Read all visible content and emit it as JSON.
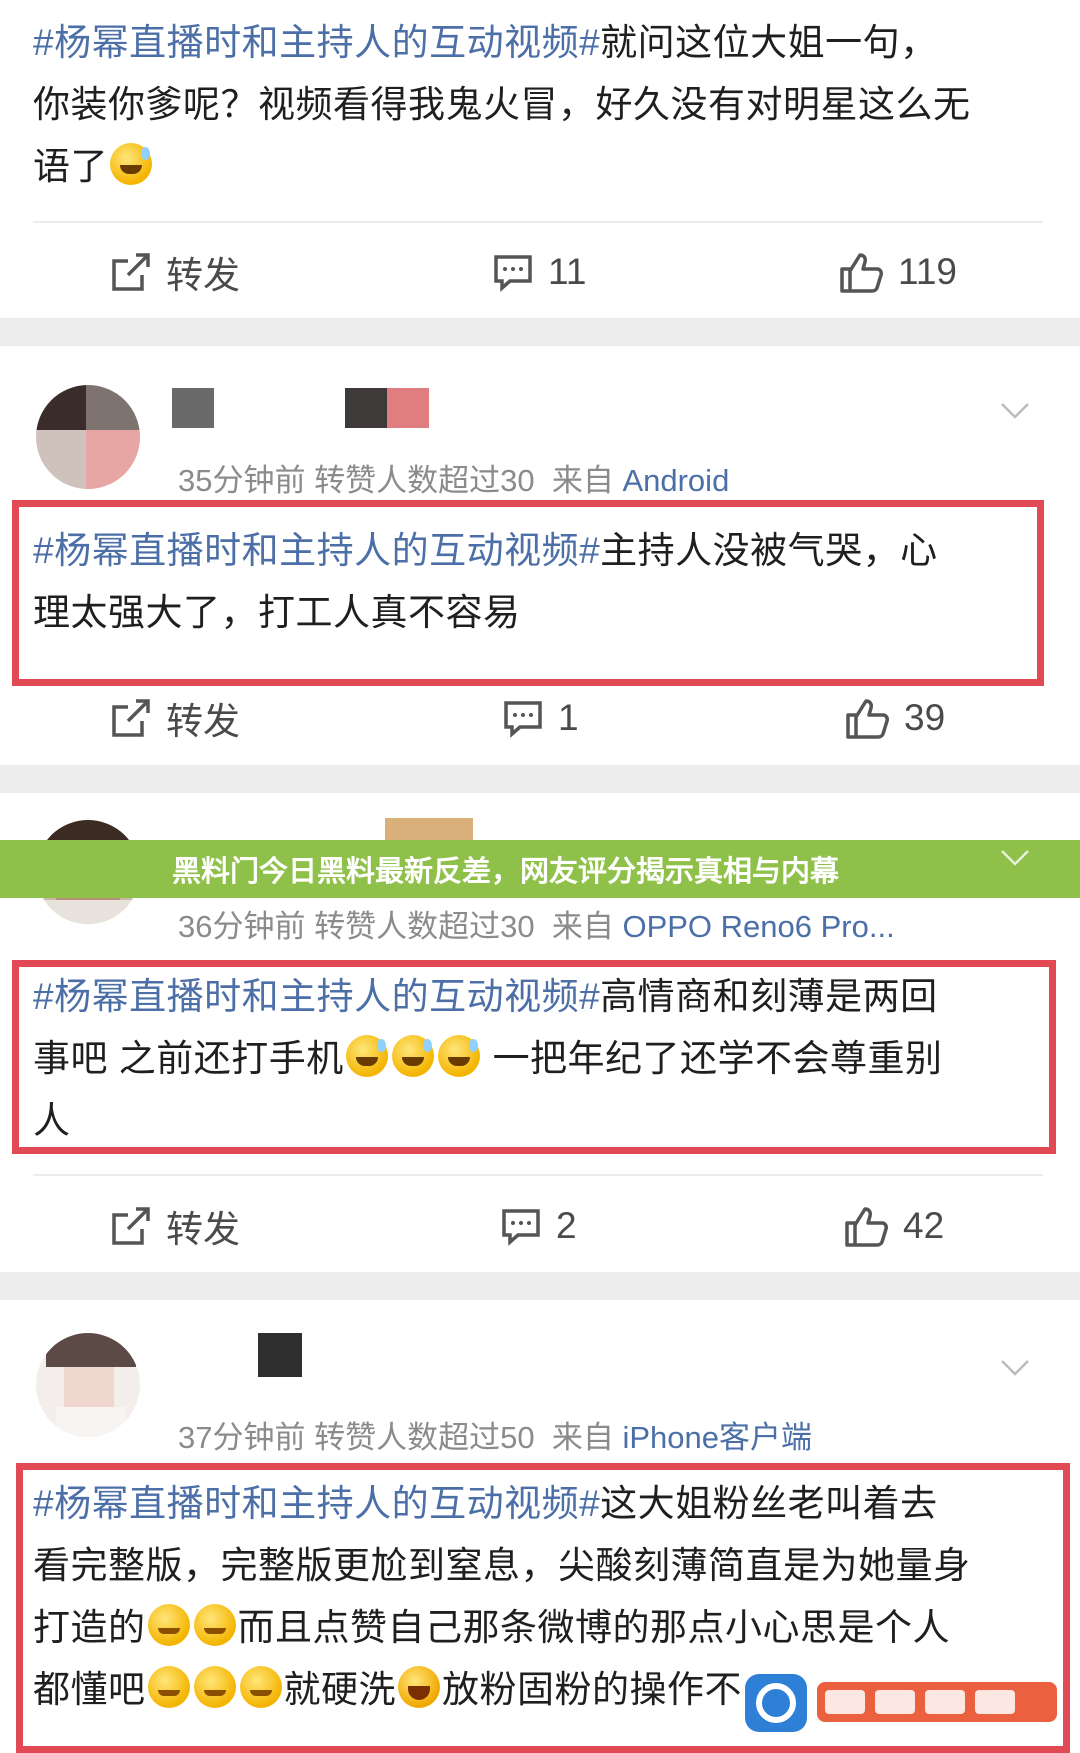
{
  "posts": [
    {
      "hashtag": "#杨幂直播时和主持人的互动视频#",
      "lines": [
        "就问这位大姐一句，",
        "你装你爹呢？视频看得我鬼火冒，好久没有对明星这么无",
        "语了"
      ],
      "actions": {
        "repost": "转发",
        "comments": "11",
        "likes": "119"
      }
    },
    {
      "meta": {
        "time": "35分钟前",
        "stat": "转赞人数超过30",
        "from": "来自",
        "source": "Android"
      },
      "hashtag": "#杨幂直播时和主持人的互动视频#",
      "lines": [
        "主持人没被气哭，心",
        "理太强大了，打工人真不容易"
      ],
      "actions": {
        "repost": "转发",
        "comments": "1",
        "likes": "39"
      }
    },
    {
      "meta": {
        "time": "36分钟前",
        "stat": "转赞人数超过30",
        "from": "来自",
        "source": "OPPO Reno6 Pro..."
      },
      "hashtag": "#杨幂直播时和主持人的互动视频#",
      "lines": [
        "高情商和刻薄是两回",
        "事吧 之前还打手机",
        "一把年纪了还学不会尊重别",
        "人"
      ],
      "actions": {
        "repost": "转发",
        "comments": "2",
        "likes": "42"
      }
    },
    {
      "meta": {
        "time": "37分钟前",
        "stat": "转赞人数超过50",
        "from": "来自",
        "source": "iPhone客户端"
      },
      "hashtag": "#杨幂直播时和主持人的互动视频#",
      "lines": [
        "这大姐粉丝老叫着去",
        "看完整版，完整版更尬到窒息，尖酸刻薄简直是为她量身",
        "打造的",
        "而且点赞自己那条微博的那点小心思是个人",
        "都懂吧",
        "就硬洗",
        "放粉固粉的操作不"
      ]
    }
  ],
  "banner": "黑料门今日黑料最新反差，网友评分揭示真相与内幕",
  "colors": {
    "hashtag": "#4c6fa8",
    "highlight_box": "#e14a55",
    "banner": "#8fc04a"
  },
  "icons": [
    "repost-icon",
    "comment-icon",
    "like-icon",
    "chevron-down-icon",
    "watermark-logo"
  ]
}
